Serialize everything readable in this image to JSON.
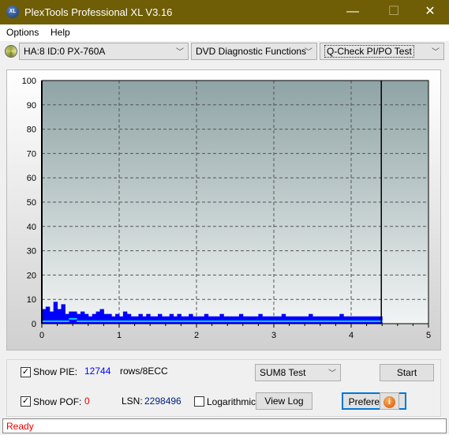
{
  "window": {
    "title": "PlexTools Professional XL V3.16",
    "logo_text": "XL",
    "minimize": "—",
    "maximize": "☐",
    "close": "✕"
  },
  "menu": [
    "Options",
    "Help"
  ],
  "toolbar": {
    "drive": "HA:8 ID:0  PX-760A",
    "function": "DVD Diagnostic Functions",
    "test": "Q-Check PI/PO Test"
  },
  "chart_data": {
    "type": "bar",
    "xlim": [
      0,
      5
    ],
    "ylim": [
      0,
      100
    ],
    "x_ticks": [
      "0",
      "1",
      "2",
      "3",
      "4",
      "5"
    ],
    "y_ticks": [
      "0",
      "10",
      "20",
      "30",
      "40",
      "50",
      "60",
      "70",
      "80",
      "90",
      "100"
    ],
    "grid": true,
    "end_marker_x": 4.39,
    "series": [
      {
        "color": "#0000ff",
        "x_step": 0.05,
        "values": [
          6,
          7,
          5,
          9,
          6,
          8,
          4,
          5,
          5,
          4,
          5,
          4,
          3,
          4,
          5,
          6,
          4,
          4,
          3,
          4,
          3,
          5,
          4,
          3,
          3,
          4,
          3,
          4,
          3,
          3,
          4,
          3,
          3,
          4,
          3,
          4,
          3,
          3,
          4,
          3,
          3,
          3,
          4,
          3,
          3,
          3,
          4,
          3,
          3,
          3,
          3,
          4,
          3,
          3,
          3,
          3,
          4,
          3,
          3,
          3,
          3,
          3,
          4,
          3,
          3,
          3,
          3,
          3,
          3,
          4,
          3,
          3,
          3,
          3,
          3,
          3,
          3,
          4,
          3,
          3,
          3,
          3,
          3,
          3,
          3,
          3,
          3,
          3
        ]
      },
      {
        "color": "#00d0ff",
        "x_step": 0.05,
        "values": [
          1,
          1,
          1,
          1,
          1,
          1,
          1,
          2,
          2,
          1,
          1,
          1,
          1,
          1,
          1,
          1,
          1,
          1,
          1,
          1,
          1,
          1,
          1,
          1,
          1,
          1,
          1,
          1,
          1,
          1,
          1,
          1,
          1,
          1,
          1,
          1,
          1,
          1,
          1,
          1,
          1,
          1,
          1,
          1,
          1,
          1,
          1,
          1,
          1,
          1,
          1,
          1,
          1,
          1,
          1,
          1,
          1,
          1,
          1,
          1,
          1,
          1,
          1,
          1,
          1,
          1,
          1,
          1,
          1,
          1,
          1,
          1,
          1,
          1,
          1,
          1,
          1,
          1,
          1,
          1,
          1,
          1,
          1,
          1,
          1,
          1,
          1,
          1
        ]
      }
    ]
  },
  "controls": {
    "show_pie_label": "Show PIE:",
    "pie_value": "12744",
    "rows_unit": "rows/8ECC",
    "show_pof_label": "Show POF:",
    "pof_value": "0",
    "lsn_label": "LSN:",
    "lsn_value": "2298496",
    "logarithmic_label": "Logarithmic",
    "test_mode": "SUM8 Test",
    "start": "Start",
    "view_log": "View Log",
    "preferences": "Preferences",
    "show_pie_checked": true,
    "show_pof_checked": true,
    "logarithmic_checked": false
  },
  "status": "Ready"
}
